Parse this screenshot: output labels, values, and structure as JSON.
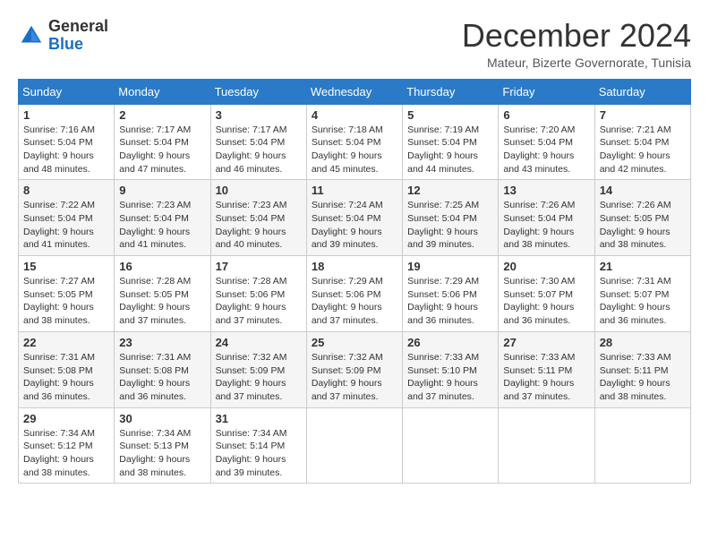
{
  "header": {
    "logo_general": "General",
    "logo_blue": "Blue",
    "month_title": "December 2024",
    "subtitle": "Mateur, Bizerte Governorate, Tunisia"
  },
  "weekdays": [
    "Sunday",
    "Monday",
    "Tuesday",
    "Wednesday",
    "Thursday",
    "Friday",
    "Saturday"
  ],
  "weeks": [
    [
      {
        "day": 1,
        "sunrise": "7:16 AM",
        "sunset": "5:04 PM",
        "daylight": "9 hours and 48 minutes."
      },
      {
        "day": 2,
        "sunrise": "7:17 AM",
        "sunset": "5:04 PM",
        "daylight": "9 hours and 47 minutes."
      },
      {
        "day": 3,
        "sunrise": "7:17 AM",
        "sunset": "5:04 PM",
        "daylight": "9 hours and 46 minutes."
      },
      {
        "day": 4,
        "sunrise": "7:18 AM",
        "sunset": "5:04 PM",
        "daylight": "9 hours and 45 minutes."
      },
      {
        "day": 5,
        "sunrise": "7:19 AM",
        "sunset": "5:04 PM",
        "daylight": "9 hours and 44 minutes."
      },
      {
        "day": 6,
        "sunrise": "7:20 AM",
        "sunset": "5:04 PM",
        "daylight": "9 hours and 43 minutes."
      },
      {
        "day": 7,
        "sunrise": "7:21 AM",
        "sunset": "5:04 PM",
        "daylight": "9 hours and 42 minutes."
      }
    ],
    [
      {
        "day": 8,
        "sunrise": "7:22 AM",
        "sunset": "5:04 PM",
        "daylight": "9 hours and 41 minutes."
      },
      {
        "day": 9,
        "sunrise": "7:23 AM",
        "sunset": "5:04 PM",
        "daylight": "9 hours and 41 minutes."
      },
      {
        "day": 10,
        "sunrise": "7:23 AM",
        "sunset": "5:04 PM",
        "daylight": "9 hours and 40 minutes."
      },
      {
        "day": 11,
        "sunrise": "7:24 AM",
        "sunset": "5:04 PM",
        "daylight": "9 hours and 39 minutes."
      },
      {
        "day": 12,
        "sunrise": "7:25 AM",
        "sunset": "5:04 PM",
        "daylight": "9 hours and 39 minutes."
      },
      {
        "day": 13,
        "sunrise": "7:26 AM",
        "sunset": "5:04 PM",
        "daylight": "9 hours and 38 minutes."
      },
      {
        "day": 14,
        "sunrise": "7:26 AM",
        "sunset": "5:05 PM",
        "daylight": "9 hours and 38 minutes."
      }
    ],
    [
      {
        "day": 15,
        "sunrise": "7:27 AM",
        "sunset": "5:05 PM",
        "daylight": "9 hours and 38 minutes."
      },
      {
        "day": 16,
        "sunrise": "7:28 AM",
        "sunset": "5:05 PM",
        "daylight": "9 hours and 37 minutes."
      },
      {
        "day": 17,
        "sunrise": "7:28 AM",
        "sunset": "5:06 PM",
        "daylight": "9 hours and 37 minutes."
      },
      {
        "day": 18,
        "sunrise": "7:29 AM",
        "sunset": "5:06 PM",
        "daylight": "9 hours and 37 minutes."
      },
      {
        "day": 19,
        "sunrise": "7:29 AM",
        "sunset": "5:06 PM",
        "daylight": "9 hours and 36 minutes."
      },
      {
        "day": 20,
        "sunrise": "7:30 AM",
        "sunset": "5:07 PM",
        "daylight": "9 hours and 36 minutes."
      },
      {
        "day": 21,
        "sunrise": "7:31 AM",
        "sunset": "5:07 PM",
        "daylight": "9 hours and 36 minutes."
      }
    ],
    [
      {
        "day": 22,
        "sunrise": "7:31 AM",
        "sunset": "5:08 PM",
        "daylight": "9 hours and 36 minutes."
      },
      {
        "day": 23,
        "sunrise": "7:31 AM",
        "sunset": "5:08 PM",
        "daylight": "9 hours and 36 minutes."
      },
      {
        "day": 24,
        "sunrise": "7:32 AM",
        "sunset": "5:09 PM",
        "daylight": "9 hours and 37 minutes."
      },
      {
        "day": 25,
        "sunrise": "7:32 AM",
        "sunset": "5:09 PM",
        "daylight": "9 hours and 37 minutes."
      },
      {
        "day": 26,
        "sunrise": "7:33 AM",
        "sunset": "5:10 PM",
        "daylight": "9 hours and 37 minutes."
      },
      {
        "day": 27,
        "sunrise": "7:33 AM",
        "sunset": "5:11 PM",
        "daylight": "9 hours and 37 minutes."
      },
      {
        "day": 28,
        "sunrise": "7:33 AM",
        "sunset": "5:11 PM",
        "daylight": "9 hours and 38 minutes."
      }
    ],
    [
      {
        "day": 29,
        "sunrise": "7:34 AM",
        "sunset": "5:12 PM",
        "daylight": "9 hours and 38 minutes."
      },
      {
        "day": 30,
        "sunrise": "7:34 AM",
        "sunset": "5:13 PM",
        "daylight": "9 hours and 38 minutes."
      },
      {
        "day": 31,
        "sunrise": "7:34 AM",
        "sunset": "5:14 PM",
        "daylight": "9 hours and 39 minutes."
      },
      null,
      null,
      null,
      null
    ]
  ]
}
